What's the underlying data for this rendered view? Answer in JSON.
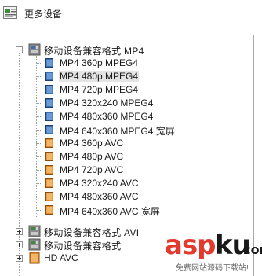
{
  "header": {
    "title": "更多设备",
    "icon": "device-list-icon"
  },
  "tree": {
    "groups": [
      {
        "label": "移动设备兼容格式 MP4",
        "expanded": true,
        "icon": "package-icon",
        "items": [
          {
            "label": "MP4 360p MPEG4",
            "color": "blue"
          },
          {
            "label": "MP4 480p MPEG4",
            "color": "blue",
            "selected": true
          },
          {
            "label": "MP4 720p MPEG4",
            "color": "blue"
          },
          {
            "label": "MP4 320x240 MPEG4",
            "color": "blue"
          },
          {
            "label": "MP4 480x360 MPEG4",
            "color": "blue"
          },
          {
            "label": "MP4 640x360 MPEG4 宽屏",
            "color": "blue"
          },
          {
            "label": "MP4 360p AVC",
            "color": "orange"
          },
          {
            "label": "MP4 480p AVC",
            "color": "orange"
          },
          {
            "label": "MP4 720p AVC",
            "color": "orange"
          },
          {
            "label": "MP4 320x240 AVC",
            "color": "orange"
          },
          {
            "label": "MP4 480x360 AVC",
            "color": "orange"
          },
          {
            "label": "MP4 640x360 AVC 宽屏",
            "color": "orange"
          }
        ]
      },
      {
        "label": "移动设备兼容格式 AVI",
        "expanded": false,
        "icon": "package-green-icon"
      },
      {
        "label": "移动设备兼容格式",
        "expanded": false,
        "icon": "package-green-icon"
      },
      {
        "label": "HD AVC",
        "expanded": false,
        "icon": "film-orange-icon"
      }
    ]
  },
  "watermark": {
    "brand_a": "asp",
    "brand_b": "ku",
    "brand_c": ".com",
    "subtitle": "免费网站源码下载站!"
  },
  "colors": {
    "film_blue": "#3c6fb0",
    "film_orange": "#e08a2a",
    "selection": "#e4e4e4",
    "brand_red": "#e23b2e"
  }
}
